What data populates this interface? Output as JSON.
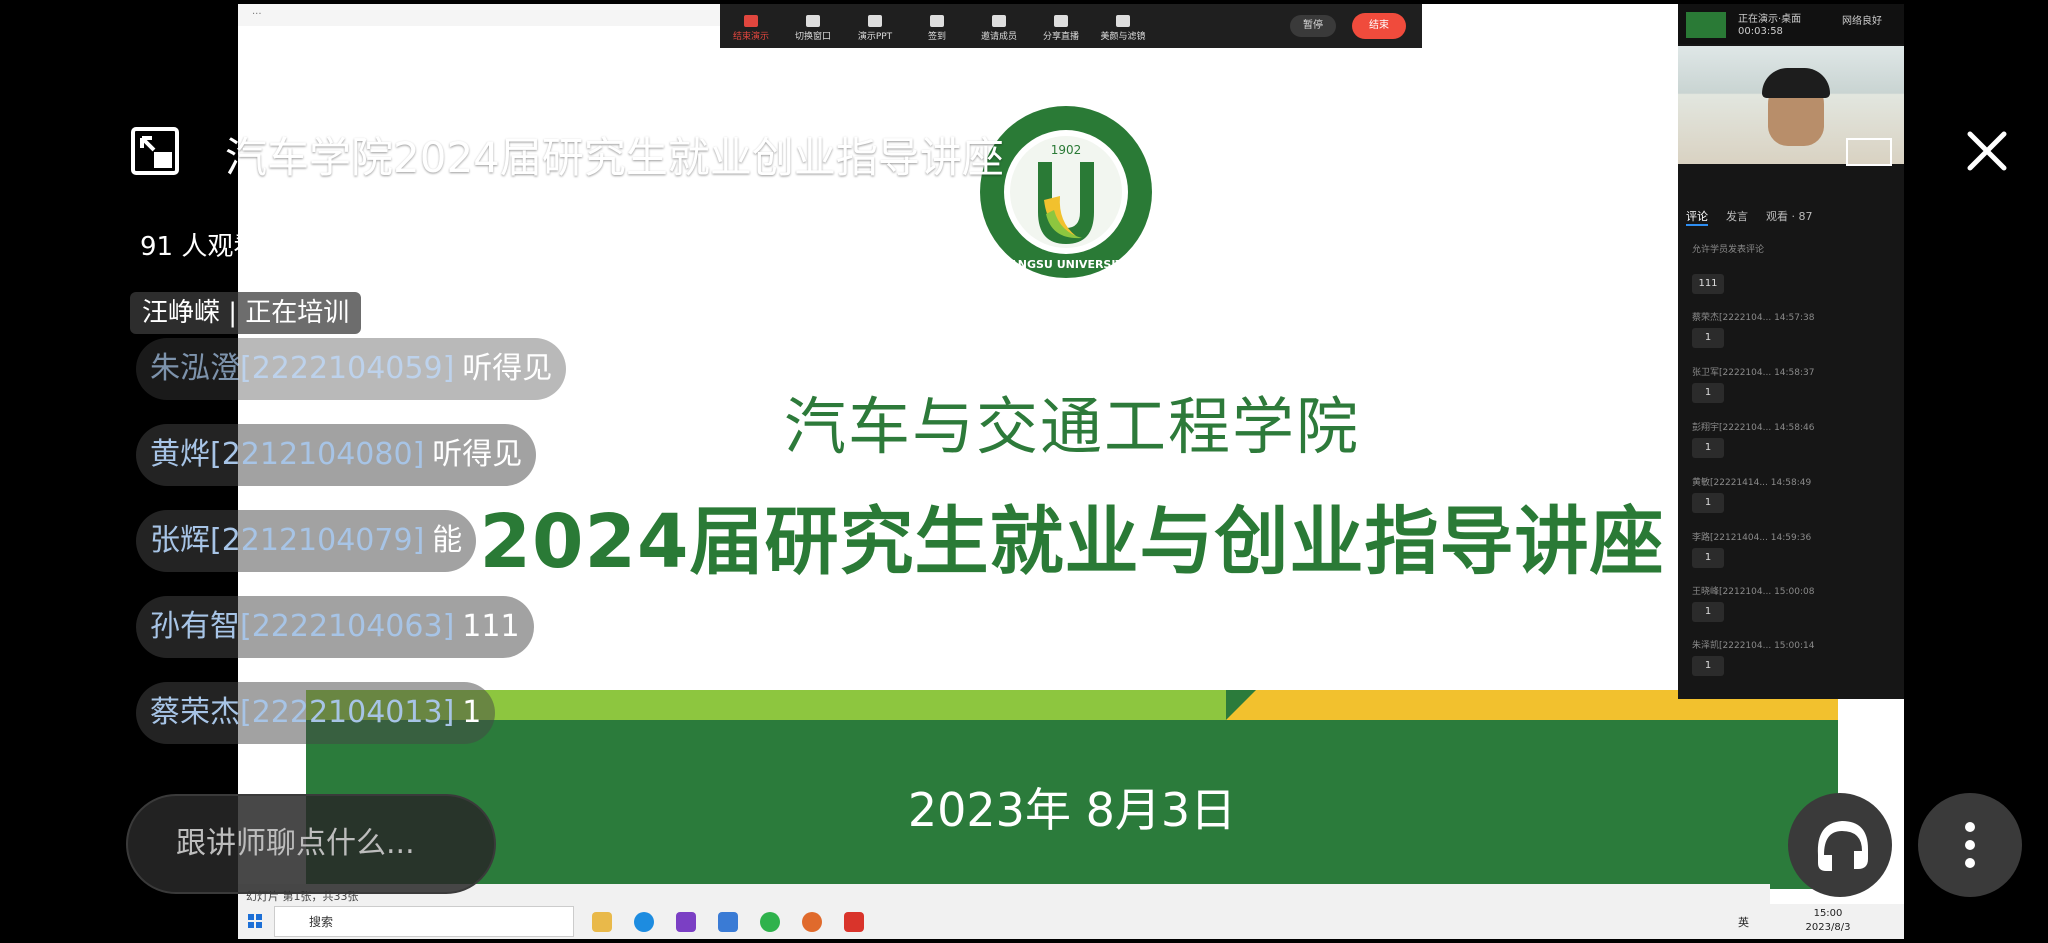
{
  "stream": {
    "title": "汽车学院2024届研究生就业创业指导讲座",
    "viewer_count": "91 人观看",
    "host_tag": "汪峥嵘 | 正在培训",
    "chat_input_placeholder": "跟讲师聊点什么..."
  },
  "chat_messages": [
    {
      "user": "朱泓澄[2222104059]",
      "text": "听得见"
    },
    {
      "user": "黄烨[2212104080]",
      "text": "听得见"
    },
    {
      "user": "张辉[2212104079]",
      "text": "能"
    },
    {
      "user": "孙有智[2222104063]",
      "text": "111"
    },
    {
      "user": "蔡荣杰[2222104013]",
      "text": "1"
    }
  ],
  "slide": {
    "logo_text": "JIANGSU UNIVERSITY",
    "logo_year": "1902",
    "title": "汽车与交通工程学院",
    "subtitle": "2024届研究生就业与创业指导讲座",
    "date": "2023年 8月3日",
    "status": "幻灯片 第1张，共33张"
  },
  "meeting_toolbar": {
    "items": [
      "结束演示",
      "切换窗口",
      "演示PPT",
      "签到",
      "邀请成员",
      "分享直播",
      "美颜与滤镜"
    ],
    "pause": "暂停",
    "end": "结束"
  },
  "right_panel": {
    "presenting": "正在演示·桌面",
    "timer": "00:03:58",
    "network": "网络良好",
    "tabs": [
      "评论",
      "发言",
      "观看 · 87"
    ],
    "hint": "允许学员发表评论",
    "comments": [
      {
        "name": "",
        "time": "",
        "text": "111"
      },
      {
        "name": "蔡荣杰[2222104...",
        "time": "14:57:38",
        "text": "1"
      },
      {
        "name": "张卫军[2222104...",
        "time": "14:58:37",
        "text": "1"
      },
      {
        "name": "彭翔宇[2222104...",
        "time": "14:58:46",
        "text": "1"
      },
      {
        "name": "黄敏[22221414...",
        "time": "14:58:49",
        "text": "1"
      },
      {
        "name": "李路[22121404...",
        "time": "14:59:36",
        "text": "1"
      },
      {
        "name": "王晓峰[2212104...",
        "time": "15:00:08",
        "text": "1"
      },
      {
        "name": "朱泽凯[2222104...",
        "time": "15:00:14",
        "text": "1"
      }
    ]
  },
  "taskbar": {
    "search": "搜索",
    "time": "15:00",
    "date": "2023/8/3",
    "lang": "英"
  }
}
